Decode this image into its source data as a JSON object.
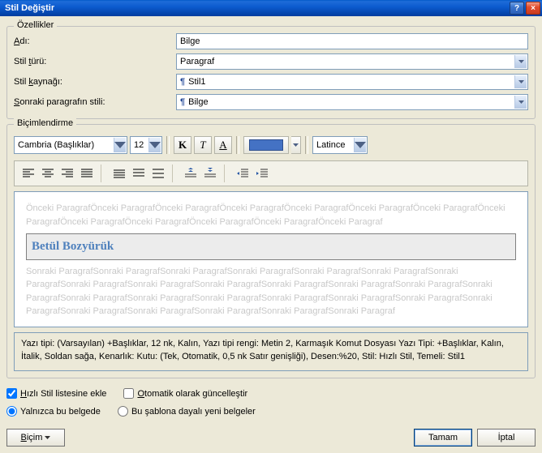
{
  "title": "Stil Değiştir",
  "groups": {
    "props": "Özellikler",
    "format": "Biçimlendirme"
  },
  "labels": {
    "name": "Adı:",
    "type": "Stil türü:",
    "based": "Stil kaynağı:",
    "following": "Sonraki paragrafın stili:"
  },
  "values": {
    "name": "Bilge",
    "type": "Paragraf",
    "based": "Stil1",
    "following": "Bilge"
  },
  "toolbar": {
    "font": "Cambria (Başlıklar)",
    "size": "12",
    "bold": "K",
    "italic": "T",
    "underline": "A",
    "lang": "Latince"
  },
  "preview": {
    "before": "Önceki ParagrafÖnceki ParagrafÖnceki ParagrafÖnceki ParagrafÖnceki ParagrafÖnceki ParagrafÖnceki ParagrafÖnceki ParagrafÖnceki ParagrafÖnceki ParagrafÖnceki ParagrafÖnceki ParagrafÖnceki Paragraf",
    "sample": "Betül Bozyürük",
    "after": "Sonraki ParagrafSonraki ParagrafSonraki ParagrafSonraki ParagrafSonraki ParagrafSonraki ParagrafSonraki ParagrafSonraki ParagrafSonraki ParagrafSonraki ParagrafSonraki ParagrafSonraki ParagrafSonraki ParagrafSonraki ParagrafSonraki ParagrafSonraki ParagrafSonraki ParagrafSonraki ParagrafSonraki ParagrafSonraki ParagrafSonraki ParagrafSonraki ParagrafSonraki ParagrafSonraki ParagrafSonraki ParagrafSonraki Paragraf"
  },
  "desc": "Yazı tipi: (Varsayılan) +Başlıklar, 12 nk, Kalın, Yazı tipi rengi: Metin 2, Karmaşık Komut Dosyası Yazı Tipi: +Başlıklar, Kalın, İtalik, Soldan sağa, Kenarlık: Kutu: (Tek, Otomatik,  0,5 nk Satır genişliği), Desen:%20, Stil: Hızlı Stil, Temeli: Stil1",
  "checks": {
    "quick": "Hızlı Stil listesine ekle",
    "auto": "Otomatik olarak güncelleştir",
    "doc": "Yalnızca bu belgede",
    "tpl": "Bu şablona dayalı yeni belgeler"
  },
  "buttons": {
    "format": "Biçim",
    "ok": "Tamam",
    "cancel": "İptal"
  },
  "colors": {
    "accent": "#4472c4"
  }
}
